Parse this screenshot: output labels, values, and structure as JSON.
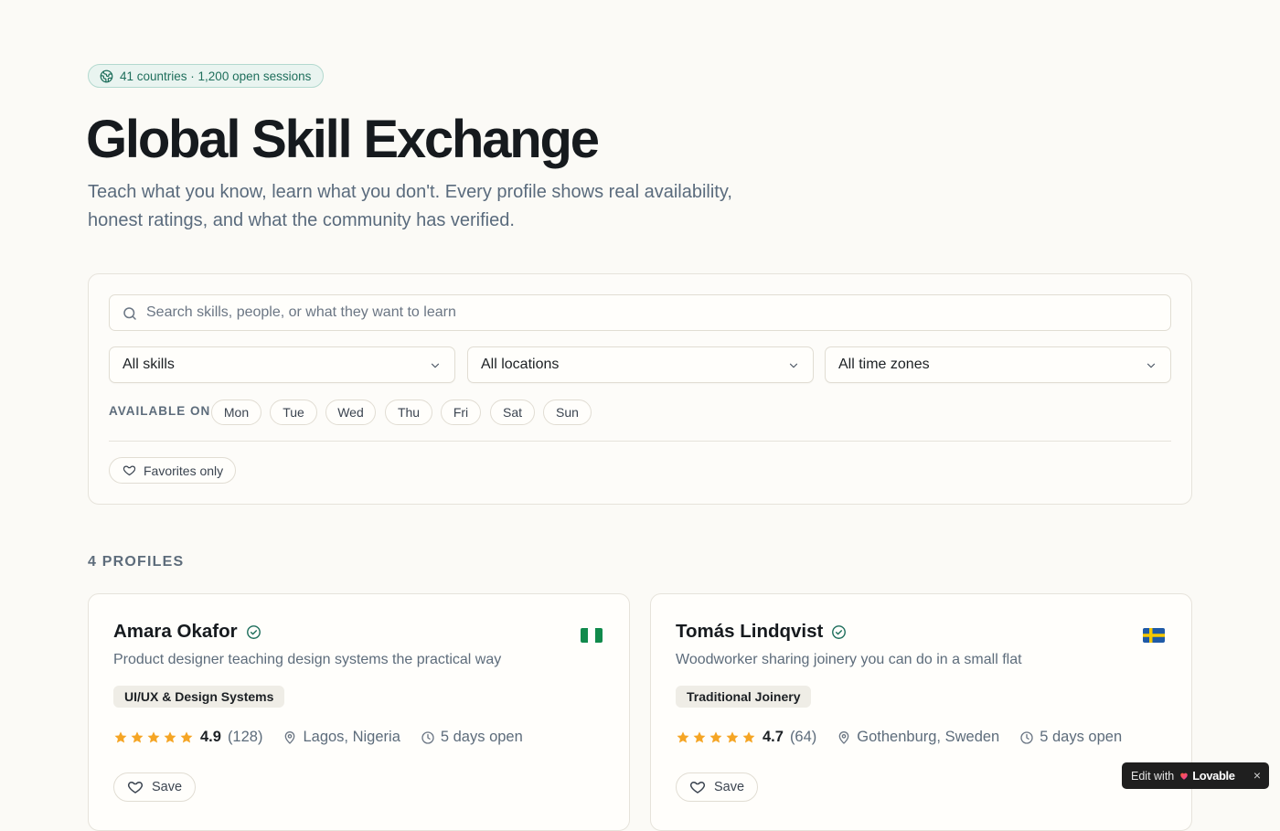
{
  "hero": {
    "badge_icon": "globe-icon",
    "badge_text": "41 countries · 1,200 open sessions",
    "title": "Global Skill Exchange",
    "subtitle_line1": "Teach what you know, learn what you don't. Every profile shows real availability,",
    "subtitle_line2": "honest ratings, and what the community has verified."
  },
  "filters": {
    "search_placeholder": "Search skills, people, or what they want to learn",
    "search_value": "",
    "skills_select": "All skills",
    "locations_select": "All locations",
    "timezones_select": "All time zones",
    "available_label": "AVAILABLE ON",
    "days": [
      "Mon",
      "Tue",
      "Wed",
      "Thu",
      "Fri",
      "Sat",
      "Sun"
    ],
    "favorites_label": "Favorites only"
  },
  "profiles": {
    "count_label": "4 PROFILES",
    "items": [
      {
        "name": "Amara Okafor",
        "flag": "nigeria-flag",
        "tagline": "Product designer teaching design systems the practical way",
        "skill": "UI/UX & Design Systems",
        "rating": "4.9",
        "reviews": "(128)",
        "location": "Lagos, Nigeria",
        "availability": "5 days open",
        "save_label": "Save"
      },
      {
        "name": "Tomás Lindqvist",
        "flag": "sweden-flag",
        "tagline": "Woodworker sharing joinery you can do in a small flat",
        "skill": "Traditional Joinery",
        "rating": "4.7",
        "reviews": "(64)",
        "location": "Gothenburg, Sweden",
        "availability": "5 days open",
        "save_label": "Save"
      }
    ]
  },
  "lovable_badge": {
    "prefix": "Edit with",
    "brand": "Lovable",
    "close": "×"
  },
  "colors": {
    "background": "#fbfaf6",
    "accent_green": "#1f6f5c",
    "star": "#f5a524",
    "muted_text": "#5d6c7b"
  }
}
